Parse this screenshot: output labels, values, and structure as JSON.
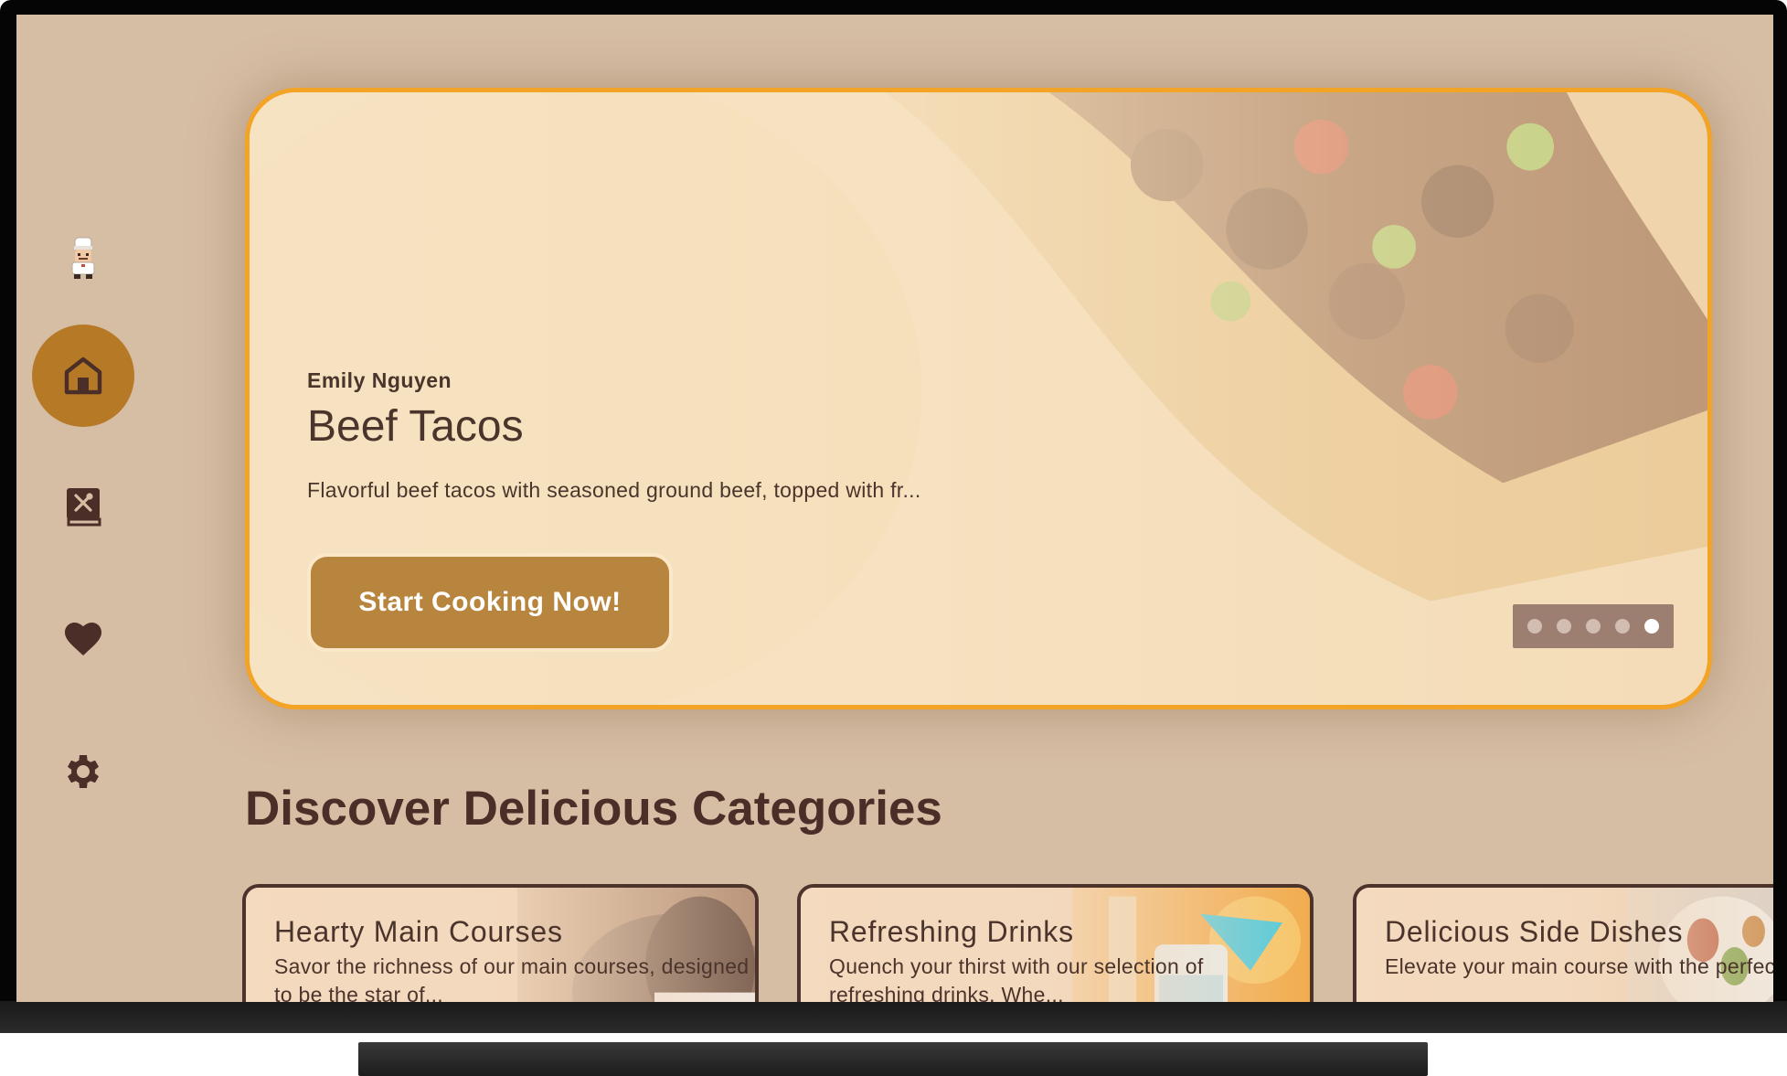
{
  "app": {
    "colors": {
      "background": "#d6bea5",
      "accent": "#f3a325",
      "primary_button": "#b8853e",
      "nav_active": "#b67a26",
      "text_dark": "#4a342c"
    }
  },
  "nav": {
    "items": [
      {
        "name": "chef-avatar",
        "icon": "chef-avatar-icon"
      },
      {
        "name": "home",
        "icon": "home-icon",
        "active": true
      },
      {
        "name": "recipes",
        "icon": "recipe-book-icon"
      },
      {
        "name": "favorites",
        "icon": "heart-icon"
      },
      {
        "name": "settings",
        "icon": "gear-icon"
      }
    ]
  },
  "hero": {
    "author": "Emily Nguyen",
    "title": "Beef Tacos",
    "description": "Flavorful beef tacos with seasoned ground beef, topped with fr...",
    "cta_label": "Start Cooking Now!",
    "carousel": {
      "total": 5,
      "active_index": 4
    }
  },
  "categories_section": {
    "title": "Discover Delicious Categories",
    "items": [
      {
        "title": "Hearty Main Courses",
        "description": "Savor the richness of our main courses, designed to be the star of..."
      },
      {
        "title": "Refreshing Drinks",
        "description": "Quench your thirst with our selection of refreshing drinks. Whe..."
      },
      {
        "title": "Delicious Side Dishes",
        "description": "Elevate your main course with the perfect side dish. From vibrant veg..."
      }
    ]
  }
}
